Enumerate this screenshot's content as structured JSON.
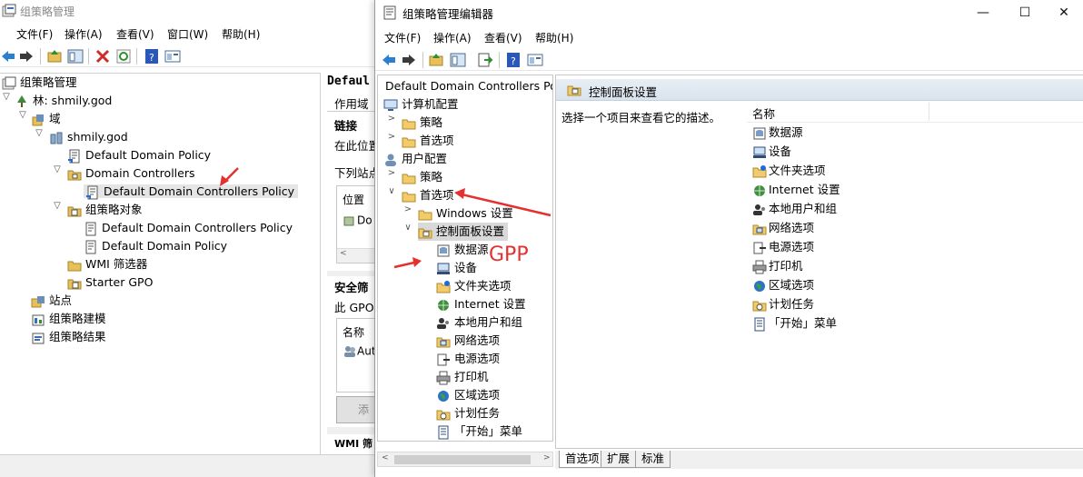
{
  "gpmc": {
    "title": "组策略管理",
    "menu": [
      "文件(F)",
      "操作(A)",
      "查看(V)",
      "窗口(W)",
      "帮助(H)"
    ],
    "tree": [
      {
        "label": "组策略管理"
      },
      {
        "label": "林: shmily.god"
      },
      {
        "label": "域"
      },
      {
        "label": "shmily.god"
      },
      {
        "label": "Default Domain Policy"
      },
      {
        "label": "Domain Controllers"
      },
      {
        "label": "Default Domain Controllers Policy"
      },
      {
        "label": "组策略对象"
      },
      {
        "label": "Default Domain Controllers Policy"
      },
      {
        "label": "Default Domain Policy"
      },
      {
        "label": "WMI 筛选器"
      },
      {
        "label": "Starter GPO"
      },
      {
        "label": "站点"
      },
      {
        "label": "组策略建模"
      },
      {
        "label": "组策略结果"
      }
    ],
    "right": {
      "title": "Defaul",
      "tab": "作用域",
      "links_label": "链接",
      "show_links": "在此位置",
      "following_sites": "下列站点",
      "location_col": "位置",
      "location_item": "Do",
      "security_label": "安全筛",
      "gpo_text": "此 GPO",
      "name_col": "名称",
      "name_item": "Aut",
      "button_stub": "添",
      "wmi_stub": "WMI 筛"
    }
  },
  "editor": {
    "title": "组策略管理编辑器",
    "menu": [
      "文件(F)",
      "操作(A)",
      "查看(V)",
      "帮助(H)"
    ],
    "window_buttons": {
      "minimize": "—",
      "maximize": "☐",
      "close": "✕"
    },
    "tree": [
      {
        "label": "Default Domain Controllers Pol"
      },
      {
        "label": "计算机配置"
      },
      {
        "label": "策略"
      },
      {
        "label": "首选项"
      },
      {
        "label": "用户配置"
      },
      {
        "label": "策略"
      },
      {
        "label": "首选项"
      },
      {
        "label": "Windows 设置"
      },
      {
        "label": "控制面板设置"
      },
      {
        "label": "数据源"
      },
      {
        "label": "设备"
      },
      {
        "label": "文件夹选项"
      },
      {
        "label": "Internet 设置"
      },
      {
        "label": "本地用户和组"
      },
      {
        "label": "网络选项"
      },
      {
        "label": "电源选项"
      },
      {
        "label": "打印机"
      },
      {
        "label": "区域选项"
      },
      {
        "label": "计划任务"
      },
      {
        "label": "「开始」菜单"
      }
    ],
    "right": {
      "header": "控制面板设置",
      "description": "选择一个项目来查看它的描述。",
      "name_col": "名称",
      "items": [
        "数据源",
        "设备",
        "文件夹选项",
        "Internet 设置",
        "本地用户和组",
        "网络选项",
        "电源选项",
        "打印机",
        "区域选项",
        "计划任务",
        "「开始」菜单"
      ]
    },
    "tabs": [
      "首选项",
      "扩展",
      "标准"
    ]
  },
  "annotation": {
    "label": "GPP",
    "color": "#e53030"
  }
}
